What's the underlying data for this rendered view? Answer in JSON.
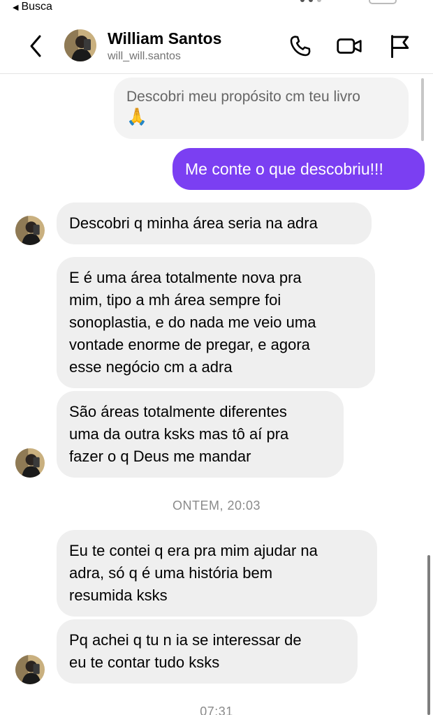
{
  "status_bar": {
    "back_app_label": "Busca"
  },
  "header": {
    "name": "William Santos",
    "handle": "will_will.santos",
    "icons": [
      "back-chevron-icon",
      "phone-icon",
      "video-camera-icon",
      "flag-icon"
    ]
  },
  "messages": [
    {
      "type": "outgoing-quoted",
      "text": "Descobri meu propósito cm teu livro",
      "emoji": "🙏"
    },
    {
      "type": "outgoing",
      "text": "Me conte o que descobriu!!!"
    },
    {
      "type": "incoming",
      "text": "Descobri q minha área seria na adra"
    },
    {
      "type": "incoming",
      "lines": [
        "E é uma área totalmente nova pra",
        "mim, tipo a mh área sempre foi",
        "sonoplastia, e do nada me veio uma",
        "vontade enorme de pregar, e agora",
        "esse negócio cm a adra"
      ]
    },
    {
      "type": "incoming",
      "lines": [
        "São áreas totalmente diferentes",
        "uma da outra ksks mas tô aí pra",
        "fazer o q Deus me mandar"
      ]
    },
    {
      "type": "timestamp",
      "text": "ONTEM, 20:03"
    },
    {
      "type": "incoming",
      "lines": [
        "Eu te contei q era pra mim ajudar na",
        "adra, só q é uma história bem",
        "resumida ksks"
      ]
    },
    {
      "type": "incoming",
      "lines": [
        "Pq achei q tu n ia se interessar de",
        "eu te contar tudo ksks"
      ]
    },
    {
      "type": "timestamp",
      "text": "07:31"
    }
  ],
  "colors": {
    "outgoing_bubble": "#7b3ff2",
    "incoming_bubble": "#efefef",
    "timestamp_text": "#8a8a8a"
  }
}
